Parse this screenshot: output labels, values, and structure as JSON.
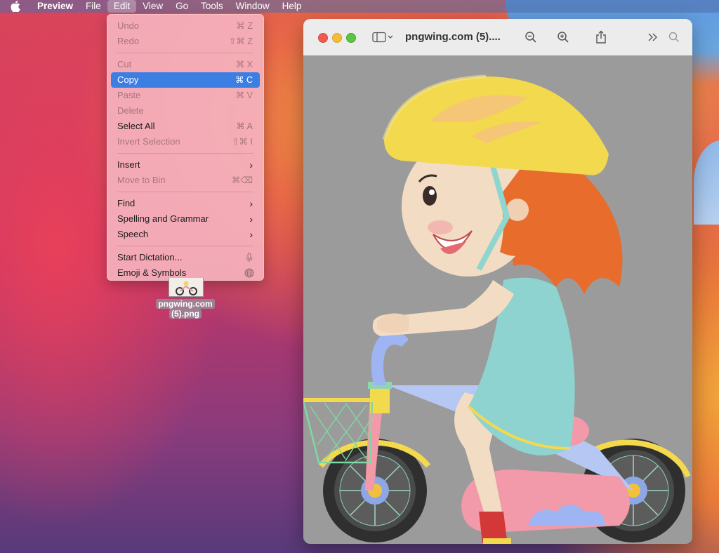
{
  "menubar": {
    "app_name": "Preview",
    "items": [
      "File",
      "Edit",
      "View",
      "Go",
      "Tools",
      "Window",
      "Help"
    ],
    "active_item": "Edit"
  },
  "edit_menu": {
    "groups": [
      [
        {
          "label": "Undo",
          "shortcut": "⌘ Z",
          "enabled": false
        },
        {
          "label": "Redo",
          "shortcut": "⇧⌘ Z",
          "enabled": false
        }
      ],
      [
        {
          "label": "Cut",
          "shortcut": "⌘ X",
          "enabled": false
        },
        {
          "label": "Copy",
          "shortcut": "⌘ C",
          "enabled": true,
          "selected": true
        },
        {
          "label": "Paste",
          "shortcut": "⌘ V",
          "enabled": false
        },
        {
          "label": "Delete",
          "shortcut": "",
          "enabled": false
        },
        {
          "label": "Select All",
          "shortcut": "⌘ A",
          "enabled": true
        },
        {
          "label": "Invert Selection",
          "shortcut": "⇧⌘ I",
          "enabled": false
        }
      ],
      [
        {
          "label": "Insert",
          "shortcut": "›",
          "enabled": true,
          "submenu": true
        },
        {
          "label": "Move to Bin",
          "shortcut": "⌘⌫",
          "enabled": false
        }
      ],
      [
        {
          "label": "Find",
          "shortcut": "›",
          "enabled": true,
          "submenu": true
        },
        {
          "label": "Spelling and Grammar",
          "shortcut": "›",
          "enabled": true,
          "submenu": true
        },
        {
          "label": "Speech",
          "shortcut": "›",
          "enabled": true,
          "submenu": true
        }
      ],
      [
        {
          "label": "Start Dictation...",
          "icon": "microphone-icon",
          "enabled": true
        },
        {
          "label": "Emoji & Symbols",
          "icon": "globe-icon",
          "enabled": true
        }
      ]
    ]
  },
  "desktop": {
    "file_label_line1": "pngwing.com",
    "file_label_line2": "(5).png"
  },
  "window": {
    "title": "pngwing.com (5)....",
    "toolbar_icons": [
      "sidebar-toggle-icon",
      "zoom-out-icon",
      "zoom-in-icon",
      "share-icon",
      "more-chevrons-icon",
      "search-icon"
    ],
    "image_subject": "girl-riding-bicycle-illustration"
  },
  "colors": {
    "menu_highlight": "#3d7ee3",
    "traffic_red": "#ee5b52",
    "traffic_yellow": "#f5bd37",
    "traffic_green": "#5bc543",
    "canvas_bg": "#9b9b9b"
  }
}
